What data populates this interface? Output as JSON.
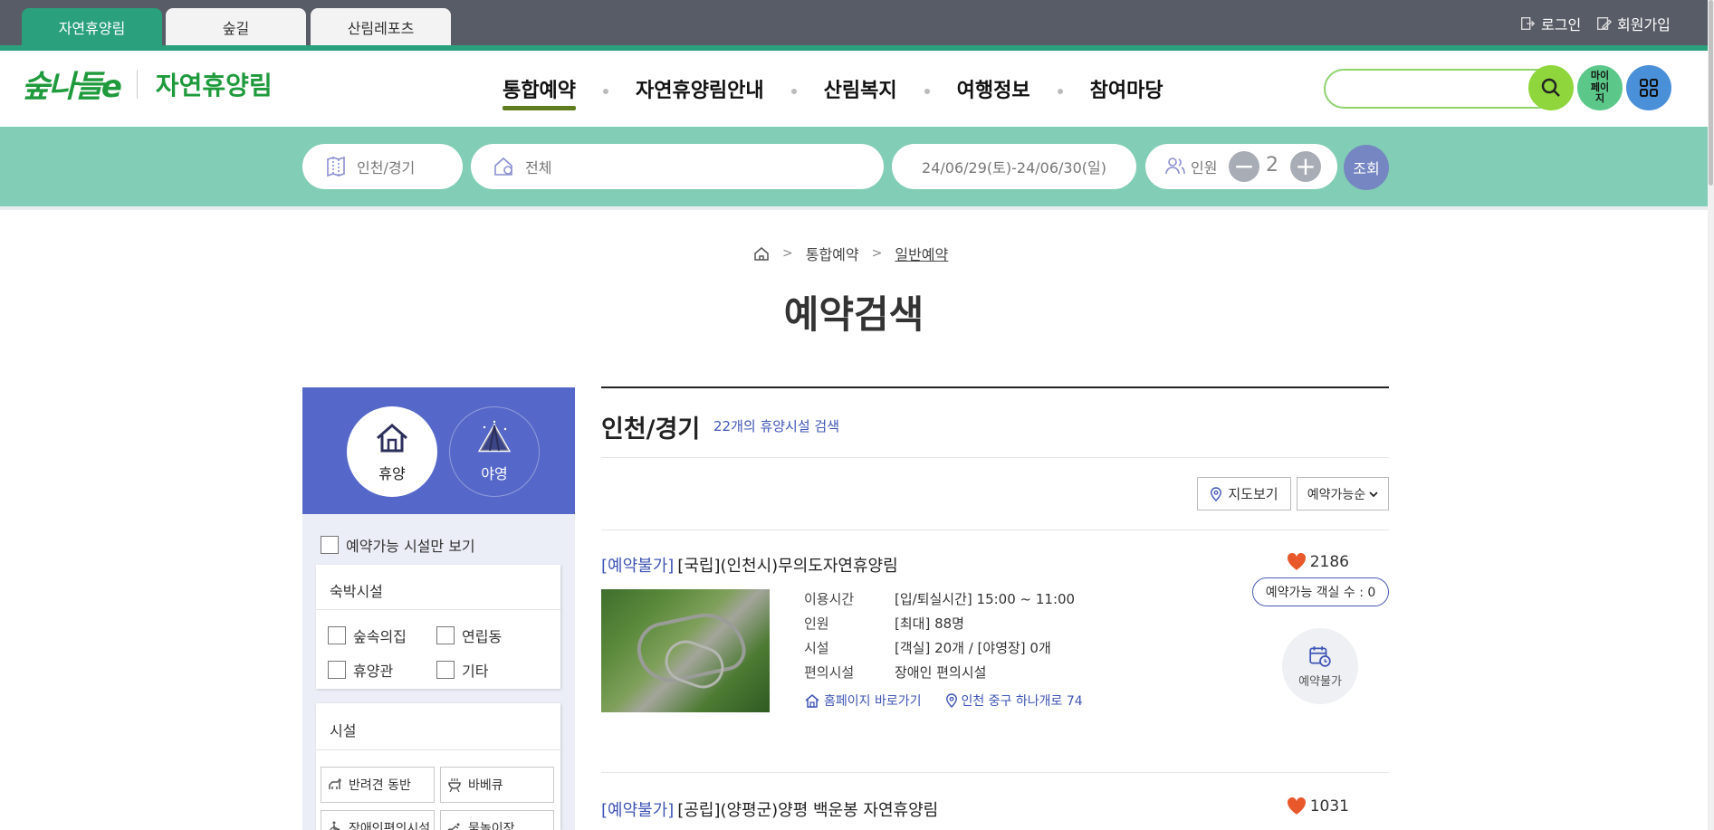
{
  "site_tabs": [
    "자연휴양림",
    "숲길",
    "산림레포츠"
  ],
  "top_links": {
    "login": "로그인",
    "join": "회원가입"
  },
  "logo": {
    "mark": "숲나들e",
    "text": "자연휴양림"
  },
  "gnb": [
    "통합예약",
    "자연휴양림안내",
    "산림복지",
    "여행정보",
    "참여마당"
  ],
  "search": {
    "placeholder": ""
  },
  "mypage_label": "마이페이지",
  "quick": {
    "region": "인천/경기",
    "facility": "전체",
    "dates": "24/06/29(토)-24/06/30(일)",
    "people_label": "인원",
    "people_count": "2",
    "search_button": "조회"
  },
  "breadcrumb": [
    "통합예약",
    "일반예약"
  ],
  "page_title": "예약검색",
  "filter": {
    "type_on": "휴양",
    "type_off": "야영",
    "available_only": "예약가능 시설만 보기",
    "lodging_title": "숙박시설",
    "lodging_items": [
      "숲속의집",
      "연립동",
      "휴양관",
      "기타"
    ],
    "facility_title": "시설",
    "facility_items": [
      "반려견 동반",
      "바베큐",
      "장애인편의시설",
      "물놀이장"
    ]
  },
  "results": {
    "region_title": "인천/경기",
    "count_text": "22개의 휴양시설 검색",
    "map_button": "지도보기",
    "sort_value": "예약가능순",
    "items": [
      {
        "status": "[예약불가]",
        "name": "[국립](인천시)무의도자연휴양림",
        "likes": "2186",
        "rows": [
          {
            "k": "이용시간",
            "v": "[입/퇴실시간] 15:00 ~ 11:00"
          },
          {
            "k": "인원",
            "v": "[최대] 88명"
          },
          {
            "k": "시설",
            "v": "[객실] 20개 / [야영장] 0개"
          },
          {
            "k": "편의시설",
            "v": "장애인 편의시설"
          }
        ],
        "homepage": "홈페이지 바로가기",
        "address": "인천 중구 하나개로 74",
        "rooms": "예약가능 객실 수 : 0",
        "reserve": "예약불가"
      },
      {
        "status": "[예약불가]",
        "name": "[공립](양평군)양평 백운봉 자연휴양림",
        "likes": "1031"
      }
    ]
  }
}
